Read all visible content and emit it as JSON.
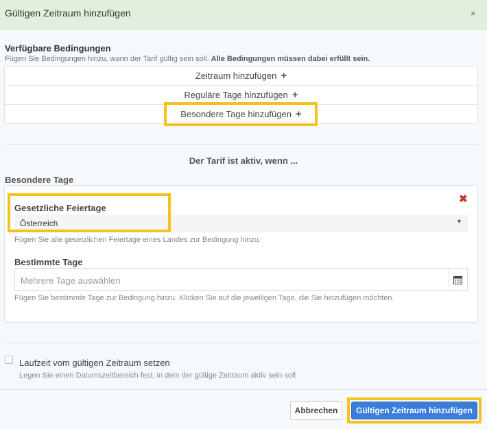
{
  "dialog": {
    "title": "Gültigen Zeitraum hinzufügen",
    "close_label": "×"
  },
  "conditions": {
    "title": "Verfügbare Bedingungen",
    "description": "Fügen Sie Bedingungen hinzu, wann der Tarif gültig sein soll.",
    "description_bold": "Alle Bedingungen müssen dabei erfüllt sein.",
    "items": [
      {
        "label": "Zeitraum hinzufügen",
        "icon": "+"
      },
      {
        "label": "Reguläre Tage hinzufügen",
        "icon": "+"
      },
      {
        "label": "Besondere Tage hinzufügen",
        "icon": "+"
      }
    ]
  },
  "active": {
    "title": "Der Tarif ist aktiv, wenn ..."
  },
  "special_days": {
    "title": "Besondere Tage",
    "remove_label": "✖",
    "holidays": {
      "label": "Gesetzliche Feiertage",
      "selected": "Österreich",
      "caret": "▼",
      "help": "Fügen Sie alle gesetzlichen Feiertage eines Landes zur Bedingung hinzu."
    },
    "specific_days": {
      "label": "Bestimmte Tage",
      "placeholder": "Mehrere Tage auswählen",
      "calendar_icon": "calendar-icon",
      "help": "Fügen Sie bestimmte Tage zur Bedingung hinzu. Klicken Sie auf die jeweiligen Tage, die Sie hinzufügen möchten."
    }
  },
  "runtime": {
    "label": "Laufzeit vom gültigen Zeitraum setzen",
    "help": "Legen Sie einen Datumszeitbereich fest, in dem der gültige Zeitraum aktiv sein soll",
    "checked": false
  },
  "footer": {
    "cancel_label": "Abbrechen",
    "submit_label": "Gültigen Zeitraum hinzufügen"
  },
  "colors": {
    "header_bg": "#e3efdc",
    "highlight": "#f5c21b",
    "primary": "#3b7ddb",
    "remove": "#c0392b"
  }
}
